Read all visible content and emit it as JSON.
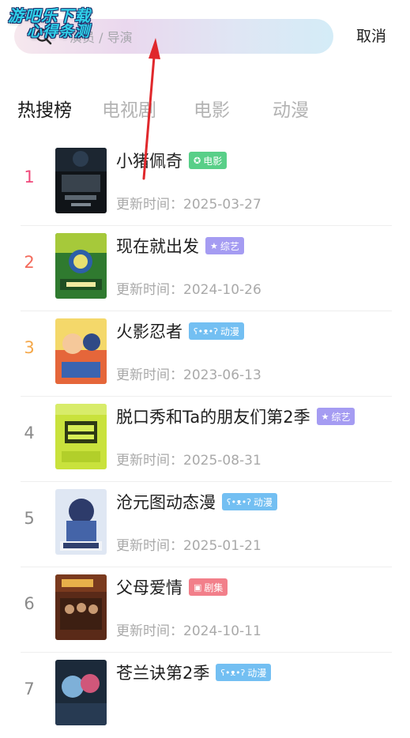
{
  "watermark": {
    "line1": "游吧乐下载",
    "line2": "心得条测"
  },
  "search": {
    "placeholder": "演员 / 导演",
    "value": ""
  },
  "cancel_label": "取消",
  "tabs": [
    "热搜榜",
    "电视剧",
    "电影",
    "动漫"
  ],
  "active_tab": 0,
  "update_prefix": "更新时间：",
  "colors": {
    "rank_1": "#f0487a",
    "rank_2": "#f36a5b",
    "rank_3": "#f5a84a",
    "rank_default": "#8a8a8a",
    "badge_movie": "#58cf88",
    "badge_variety": "#a59cf2",
    "badge_anime": "#73bff2",
    "badge_drama": "#f27f8a",
    "arrow": "#e0282c"
  },
  "items": [
    {
      "rank": "1",
      "title": "小猪佩奇",
      "badge": "电影",
      "badge_type": "movie",
      "badge_icon": "film-reel-icon",
      "date": "2025-03-27"
    },
    {
      "rank": "2",
      "title": "现在就出发",
      "badge": "综艺",
      "badge_type": "variety",
      "badge_icon": "star-icon",
      "date": "2024-10-26"
    },
    {
      "rank": "3",
      "title": "火影忍者",
      "badge": "动漫",
      "badge_type": "anime",
      "badge_icon": "bear-icon",
      "date": "2023-06-13"
    },
    {
      "rank": "4",
      "title": "脱口秀和Ta的朋友们第2季",
      "badge": "综艺",
      "badge_type": "variety",
      "badge_icon": "star-icon",
      "date": "2025-08-31"
    },
    {
      "rank": "5",
      "title": "沧元图动态漫",
      "badge": "动漫",
      "badge_type": "anime",
      "badge_icon": "bear-icon",
      "date": "2025-01-21"
    },
    {
      "rank": "6",
      "title": "父母爱情",
      "badge": "剧集",
      "badge_type": "drama",
      "badge_icon": "tv-icon",
      "date": "2024-10-11"
    },
    {
      "rank": "7",
      "title": "苍兰诀第2季",
      "badge": "动漫",
      "badge_type": "anime",
      "badge_icon": "bear-icon",
      "date": ""
    }
  ]
}
